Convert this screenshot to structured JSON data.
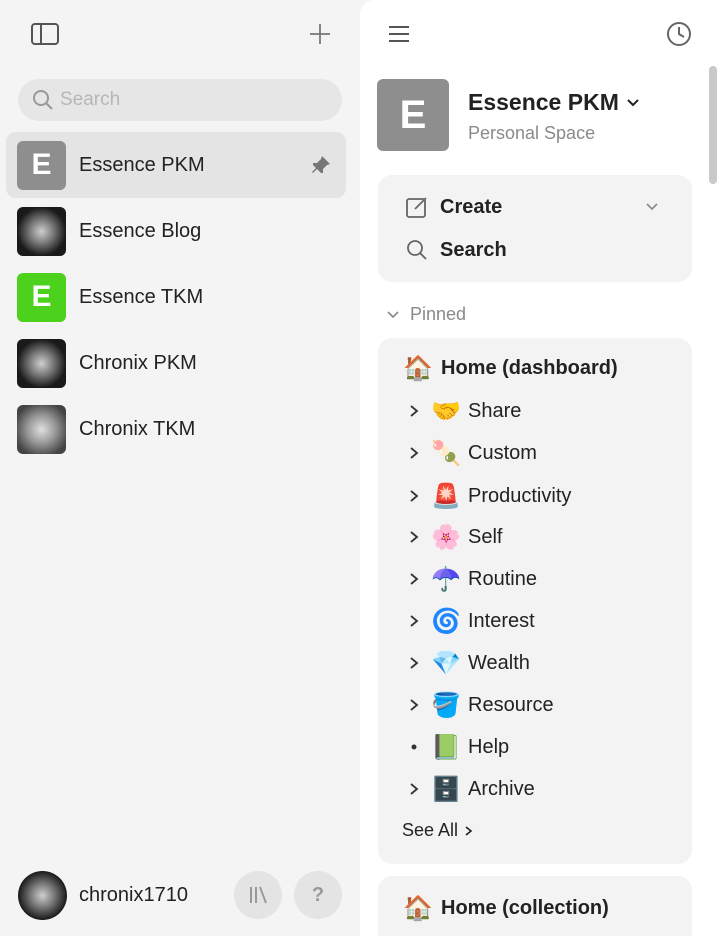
{
  "sidebar": {
    "search_placeholder": "Search",
    "workspaces": [
      {
        "label": "Essence PKM",
        "avatar_letter": "E",
        "avatar_color": "#8e8e8e",
        "active": true,
        "pinned": true
      },
      {
        "label": "Essence Blog",
        "avatar_letter": "",
        "avatar_color": "image",
        "active": false,
        "pinned": false
      },
      {
        "label": "Essence TKM",
        "avatar_letter": "E",
        "avatar_color": "#4cd11c",
        "active": false,
        "pinned": false
      },
      {
        "label": "Chronix PKM",
        "avatar_letter": "",
        "avatar_color": "image",
        "active": false,
        "pinned": false
      },
      {
        "label": "Chronix TKM",
        "avatar_letter": "",
        "avatar_color": "image",
        "active": false,
        "pinned": false
      }
    ],
    "user": {
      "name": "chronix1710"
    },
    "help_label": "?"
  },
  "space": {
    "avatar_letter": "E",
    "name": "Essence PKM",
    "subtitle": "Personal Space"
  },
  "actions": {
    "create_label": "Create",
    "search_label": "Search"
  },
  "pinned": {
    "heading": "Pinned",
    "home": {
      "emoji": "🏠",
      "label": "Home (dashboard)"
    },
    "items": [
      {
        "emoji": "🤝",
        "label": "Share",
        "expandable": true
      },
      {
        "emoji": "🍡",
        "label": "Custom",
        "expandable": true
      },
      {
        "emoji": "🚨",
        "label": "Productivity",
        "expandable": true
      },
      {
        "emoji": "🌸",
        "label": "Self",
        "expandable": true
      },
      {
        "emoji": "☂️",
        "label": "Routine",
        "expandable": true
      },
      {
        "emoji": "🌀",
        "label": "Interest",
        "expandable": true
      },
      {
        "emoji": "💎",
        "label": "Wealth",
        "expandable": true
      },
      {
        "emoji": "🪣",
        "label": "Resource",
        "expandable": true
      },
      {
        "emoji": "📗",
        "label": "Help",
        "expandable": false
      },
      {
        "emoji": "🗄️",
        "label": "Archive",
        "expandable": true
      }
    ],
    "see_all_label": "See All"
  },
  "collection": {
    "home": {
      "emoji": "🏠",
      "label": "Home (collection)"
    }
  }
}
